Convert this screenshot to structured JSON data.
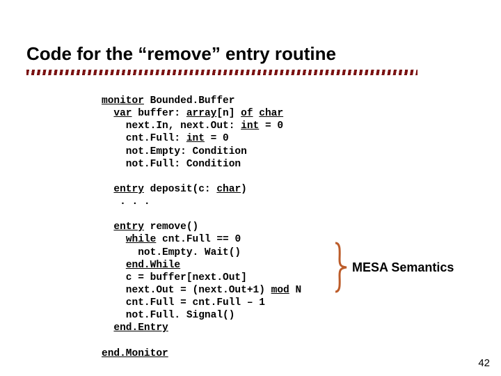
{
  "title": "Code for the “remove” entry routine",
  "code": {
    "l01a": "monitor",
    "l01b": " Bounded.Buffer",
    "l02a": "  ",
    "l02b": "var",
    "l02c": " buffer: ",
    "l02d": "array",
    "l02e": "[n] ",
    "l02f": "of",
    "l02g": " ",
    "l02h": "char",
    "l03a": "    next.In, next.Out: ",
    "l03b": "int",
    "l03c": " = 0",
    "l04a": "    cnt.Full: ",
    "l04b": "int",
    "l04c": " = 0",
    "l05": "    not.Empty: Condition",
    "l06": "    not.Full: Condition",
    "l07a": "  ",
    "l07b": "entry",
    "l07c": " deposit(c: ",
    "l07d": "char",
    "l07e": ")",
    "l08": "   . . .",
    "l09a": "  ",
    "l09b": "entry",
    "l09c": " remove()",
    "l10a": "    ",
    "l10b": "while",
    "l10c": " cnt.Full == 0",
    "l11": "      not.Empty. Wait()",
    "l12a": "    ",
    "l12b": "end.While",
    "l13": "    c = buffer[next.Out]",
    "l14a": "    next.Out = (next.Out+1) ",
    "l14b": "mod",
    "l14c": " N",
    "l15": "    cnt.Full = cnt.Full – 1",
    "l16": "    not.Full. Signal()",
    "l17a": "  ",
    "l17b": "end.Entry",
    "l18": "end.Monitor"
  },
  "annotation": "MESA Semantics",
  "page_number": "42"
}
